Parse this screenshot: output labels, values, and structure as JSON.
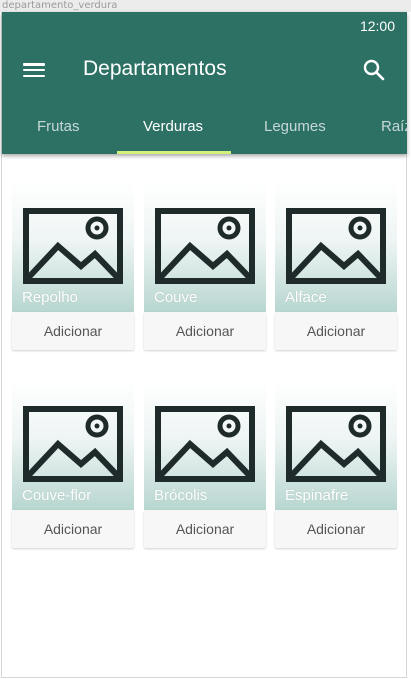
{
  "frame_label": "departamento_verdura",
  "status_bar": {
    "time": "12:00"
  },
  "app_bar": {
    "title": "Departamentos"
  },
  "tabs": [
    {
      "label": "Frutas",
      "active": false
    },
    {
      "label": "Verduras",
      "active": true
    },
    {
      "label": "Legumes",
      "active": false
    },
    {
      "label": "Raízes",
      "active": false
    }
  ],
  "products": [
    {
      "name": "Repolho",
      "button": "Adicionar"
    },
    {
      "name": "Couve",
      "button": "Adicionar"
    },
    {
      "name": "Alface",
      "button": "Adicionar"
    },
    {
      "name": "Couve-flor",
      "button": "Adicionar"
    },
    {
      "name": "Brócolis",
      "button": "Adicionar"
    },
    {
      "name": "Espinafre",
      "button": "Adicionar"
    }
  ],
  "colors": {
    "primary": "#2d7165",
    "tab_indicator": "#d4f07c"
  }
}
